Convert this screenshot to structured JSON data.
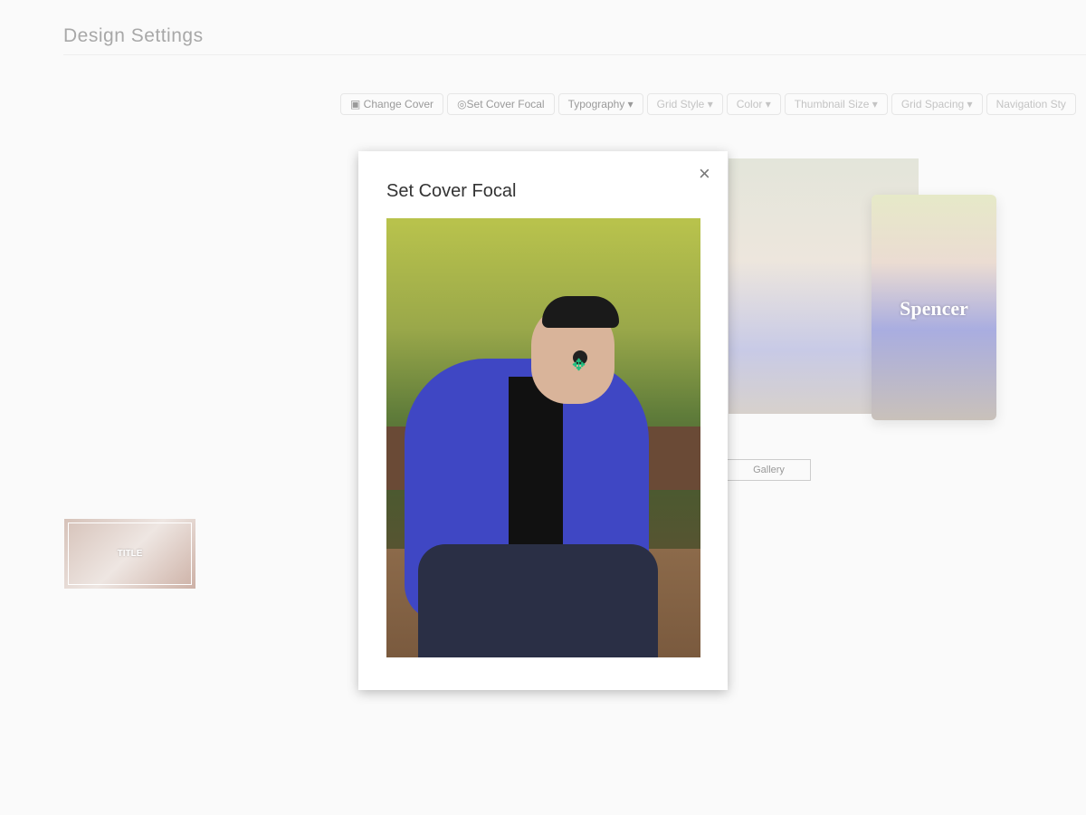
{
  "page": {
    "title": "Design Settings"
  },
  "toolbar": [
    {
      "label": "Change Cover",
      "icon": "image-icon"
    },
    {
      "label": "Set Cover Focal",
      "icon": "target-icon"
    },
    {
      "label": "Typography ▾"
    },
    {
      "label": "Grid Style ▾"
    },
    {
      "label": "Color ▾"
    },
    {
      "label": "Thumbnail Size ▾"
    },
    {
      "label": "Grid Spacing ▾"
    },
    {
      "label": "Navigation Sty"
    }
  ],
  "preview": {
    "name": "Spencer",
    "gallery_button": "Gallery",
    "thumb_title": "TITLE"
  },
  "modal": {
    "title": "Set Cover Focal",
    "close": "×",
    "focal_icon": "move-icon"
  }
}
